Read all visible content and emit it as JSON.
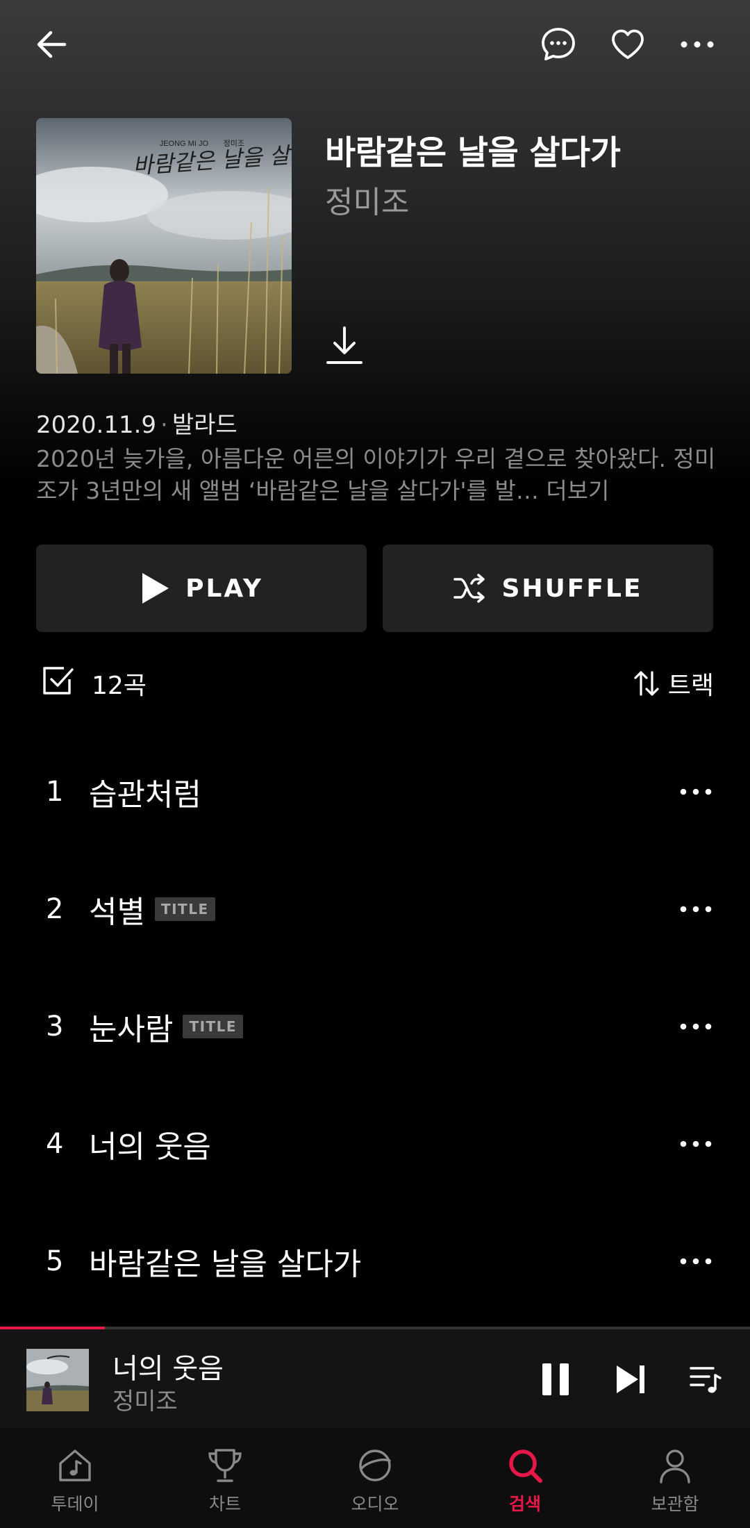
{
  "header": {
    "back_icon": "arrow-left-icon",
    "comment_icon": "chat-bubble-icon",
    "like_icon": "heart-icon",
    "more_icon": "more-horizontal-icon"
  },
  "album": {
    "title": "바람같은 날을 살다가",
    "artist": "정미조",
    "cover_text_en": "JEONG MI JO",
    "cover_text_ko": "정미조",
    "cover_script": "바람같은 날을 살다가",
    "release_date": "2020.11.9",
    "separator": "·",
    "genre": "발라드",
    "description": "2020년 늦가을, 아름다운 어른의 이야기가 우리 곁으로 찾아왔다. 정미조가 3년만의 새 앨범 ‘바람같은 날을 살다가'를 발…",
    "more_label": "더보기"
  },
  "actions": {
    "play_label": "PLAY",
    "shuffle_label": "SHUFFLE"
  },
  "list": {
    "count_label": "12곡",
    "sort_label": "트랙"
  },
  "tracks": [
    {
      "num": "1",
      "title": "습관처럼",
      "badge": ""
    },
    {
      "num": "2",
      "title": "석별",
      "badge": "TITLE"
    },
    {
      "num": "3",
      "title": "눈사람",
      "badge": "TITLE"
    },
    {
      "num": "4",
      "title": "너의 웃음",
      "badge": ""
    },
    {
      "num": "5",
      "title": "바람같은 날을 살다가",
      "badge": ""
    }
  ],
  "now_playing": {
    "title": "너의 웃음",
    "artist": "정미조",
    "progress": 0.14
  },
  "nav": [
    {
      "label": "투데이",
      "icon": "home-music-icon",
      "active": false
    },
    {
      "label": "차트",
      "icon": "trophy-icon",
      "active": false
    },
    {
      "label": "오디오",
      "icon": "planet-icon",
      "active": false
    },
    {
      "label": "검색",
      "icon": "search-icon",
      "active": true
    },
    {
      "label": "보관함",
      "icon": "person-icon",
      "active": false
    }
  ],
  "colors": {
    "accent": "#e8174a",
    "button_bg": "#222223",
    "muted_text": "#8c8c8c"
  }
}
